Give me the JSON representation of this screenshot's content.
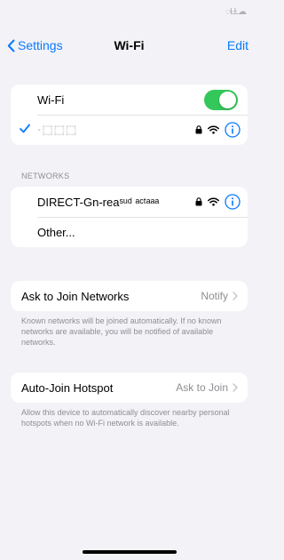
{
  "status_bar": {
    "glyph": "◌ⱢⱢ☁"
  },
  "nav": {
    "back_label": "Settings",
    "title": "Wi-Fi",
    "edit_label": "Edit"
  },
  "wifi_group": {
    "toggle_label": "Wi-Fi",
    "toggle_on": true,
    "connected_network": "·⬚⬚⬚"
  },
  "networks": {
    "section_header": "NETWORKS",
    "items": [
      {
        "name": "DIRECT-Gn-reaˢᵘᵈ ᵃᶜᵗᵃᵃᵃ",
        "secured": true
      },
      {
        "name": "Other..."
      }
    ]
  },
  "ask_to_join": {
    "label": "Ask to Join Networks",
    "value": "Notify",
    "footnote": "Known networks will be joined automatically. If no known networks are available, you will be notified of available networks."
  },
  "auto_join": {
    "label": "Auto-Join Hotspot",
    "value": "Ask to Join",
    "footnote": "Allow this device to automatically discover nearby personal hotspots when no Wi-Fi network is available."
  },
  "colors": {
    "accent": "#0a7aff",
    "toggle_on": "#34c759",
    "background": "#f2f2f7"
  }
}
